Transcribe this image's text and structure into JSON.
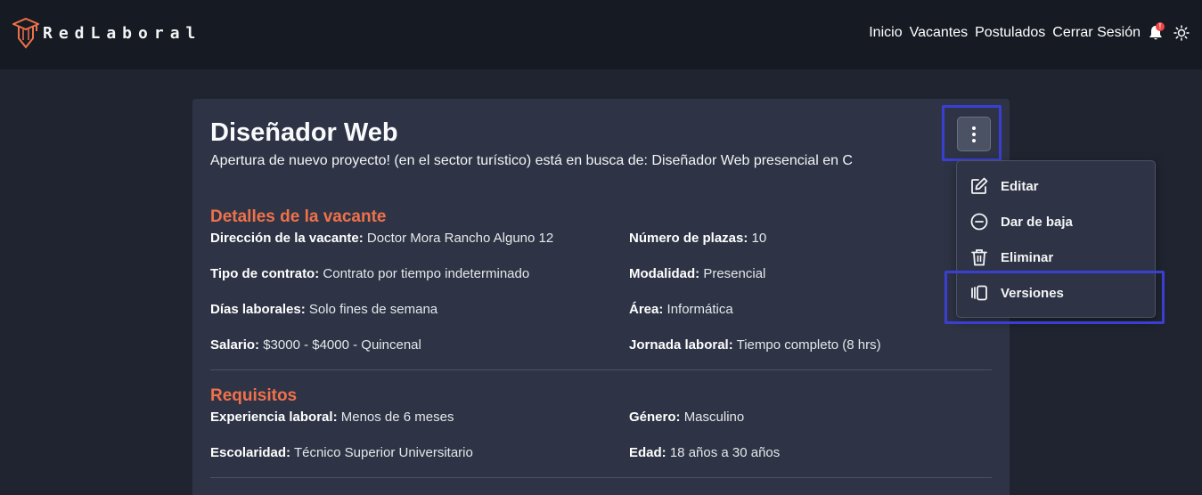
{
  "brand": {
    "name": "RedLaboral",
    "icon": "graduation-cap-pencil-logo",
    "color": "#f0714a"
  },
  "nav": {
    "links": [
      "Inicio",
      "Vacantes",
      "Postulados",
      "Cerrar Sesión"
    ],
    "notification_badge": "!",
    "icons": [
      "bell-icon",
      "sun-icon"
    ]
  },
  "job": {
    "title": "Diseñador Web",
    "description": "Apertura de nuevo proyecto! (en el sector turístico) está en busca de: Diseñador Web presencial en C"
  },
  "details": {
    "section_title": "Detalles de la vacante",
    "fields": [
      {
        "label": "Dirección de la vacante:",
        "value": "Doctor Mora Rancho Alguno 12"
      },
      {
        "label": "Número de plazas:",
        "value": "10"
      },
      {
        "label": "Tipo de contrato:",
        "value": "Contrato por tiempo indeterminado"
      },
      {
        "label": "Modalidad:",
        "value": "Presencial"
      },
      {
        "label": "Días laborales:",
        "value": "Solo fines de semana"
      },
      {
        "label": "Área:",
        "value": "Informática"
      },
      {
        "label": "Salario:",
        "value": "$3000 - $4000 - Quincenal"
      },
      {
        "label": "Jornada laboral:",
        "value": "Tiempo completo (8 hrs)"
      }
    ]
  },
  "requirements": {
    "section_title": "Requisitos",
    "fields": [
      {
        "label": "Experiencia laboral:",
        "value": "Menos de 6 meses"
      },
      {
        "label": "Género:",
        "value": "Masculino"
      },
      {
        "label": "Escolaridad:",
        "value": "Técnico Superior Universitario"
      },
      {
        "label": "Edad:",
        "value": "18 años a 30 años"
      }
    ]
  },
  "menu": {
    "items": [
      {
        "label": "Editar",
        "icon": "edit-icon"
      },
      {
        "label": "Dar de baja",
        "icon": "minus-circle-icon"
      },
      {
        "label": "Eliminar",
        "icon": "trash-icon"
      },
      {
        "label": "Versiones",
        "icon": "versions-icon"
      }
    ]
  },
  "colors": {
    "accent": "#f0714a",
    "highlight": "#3b3fd1",
    "card": "#2e3445",
    "navbar": "#161a22"
  }
}
